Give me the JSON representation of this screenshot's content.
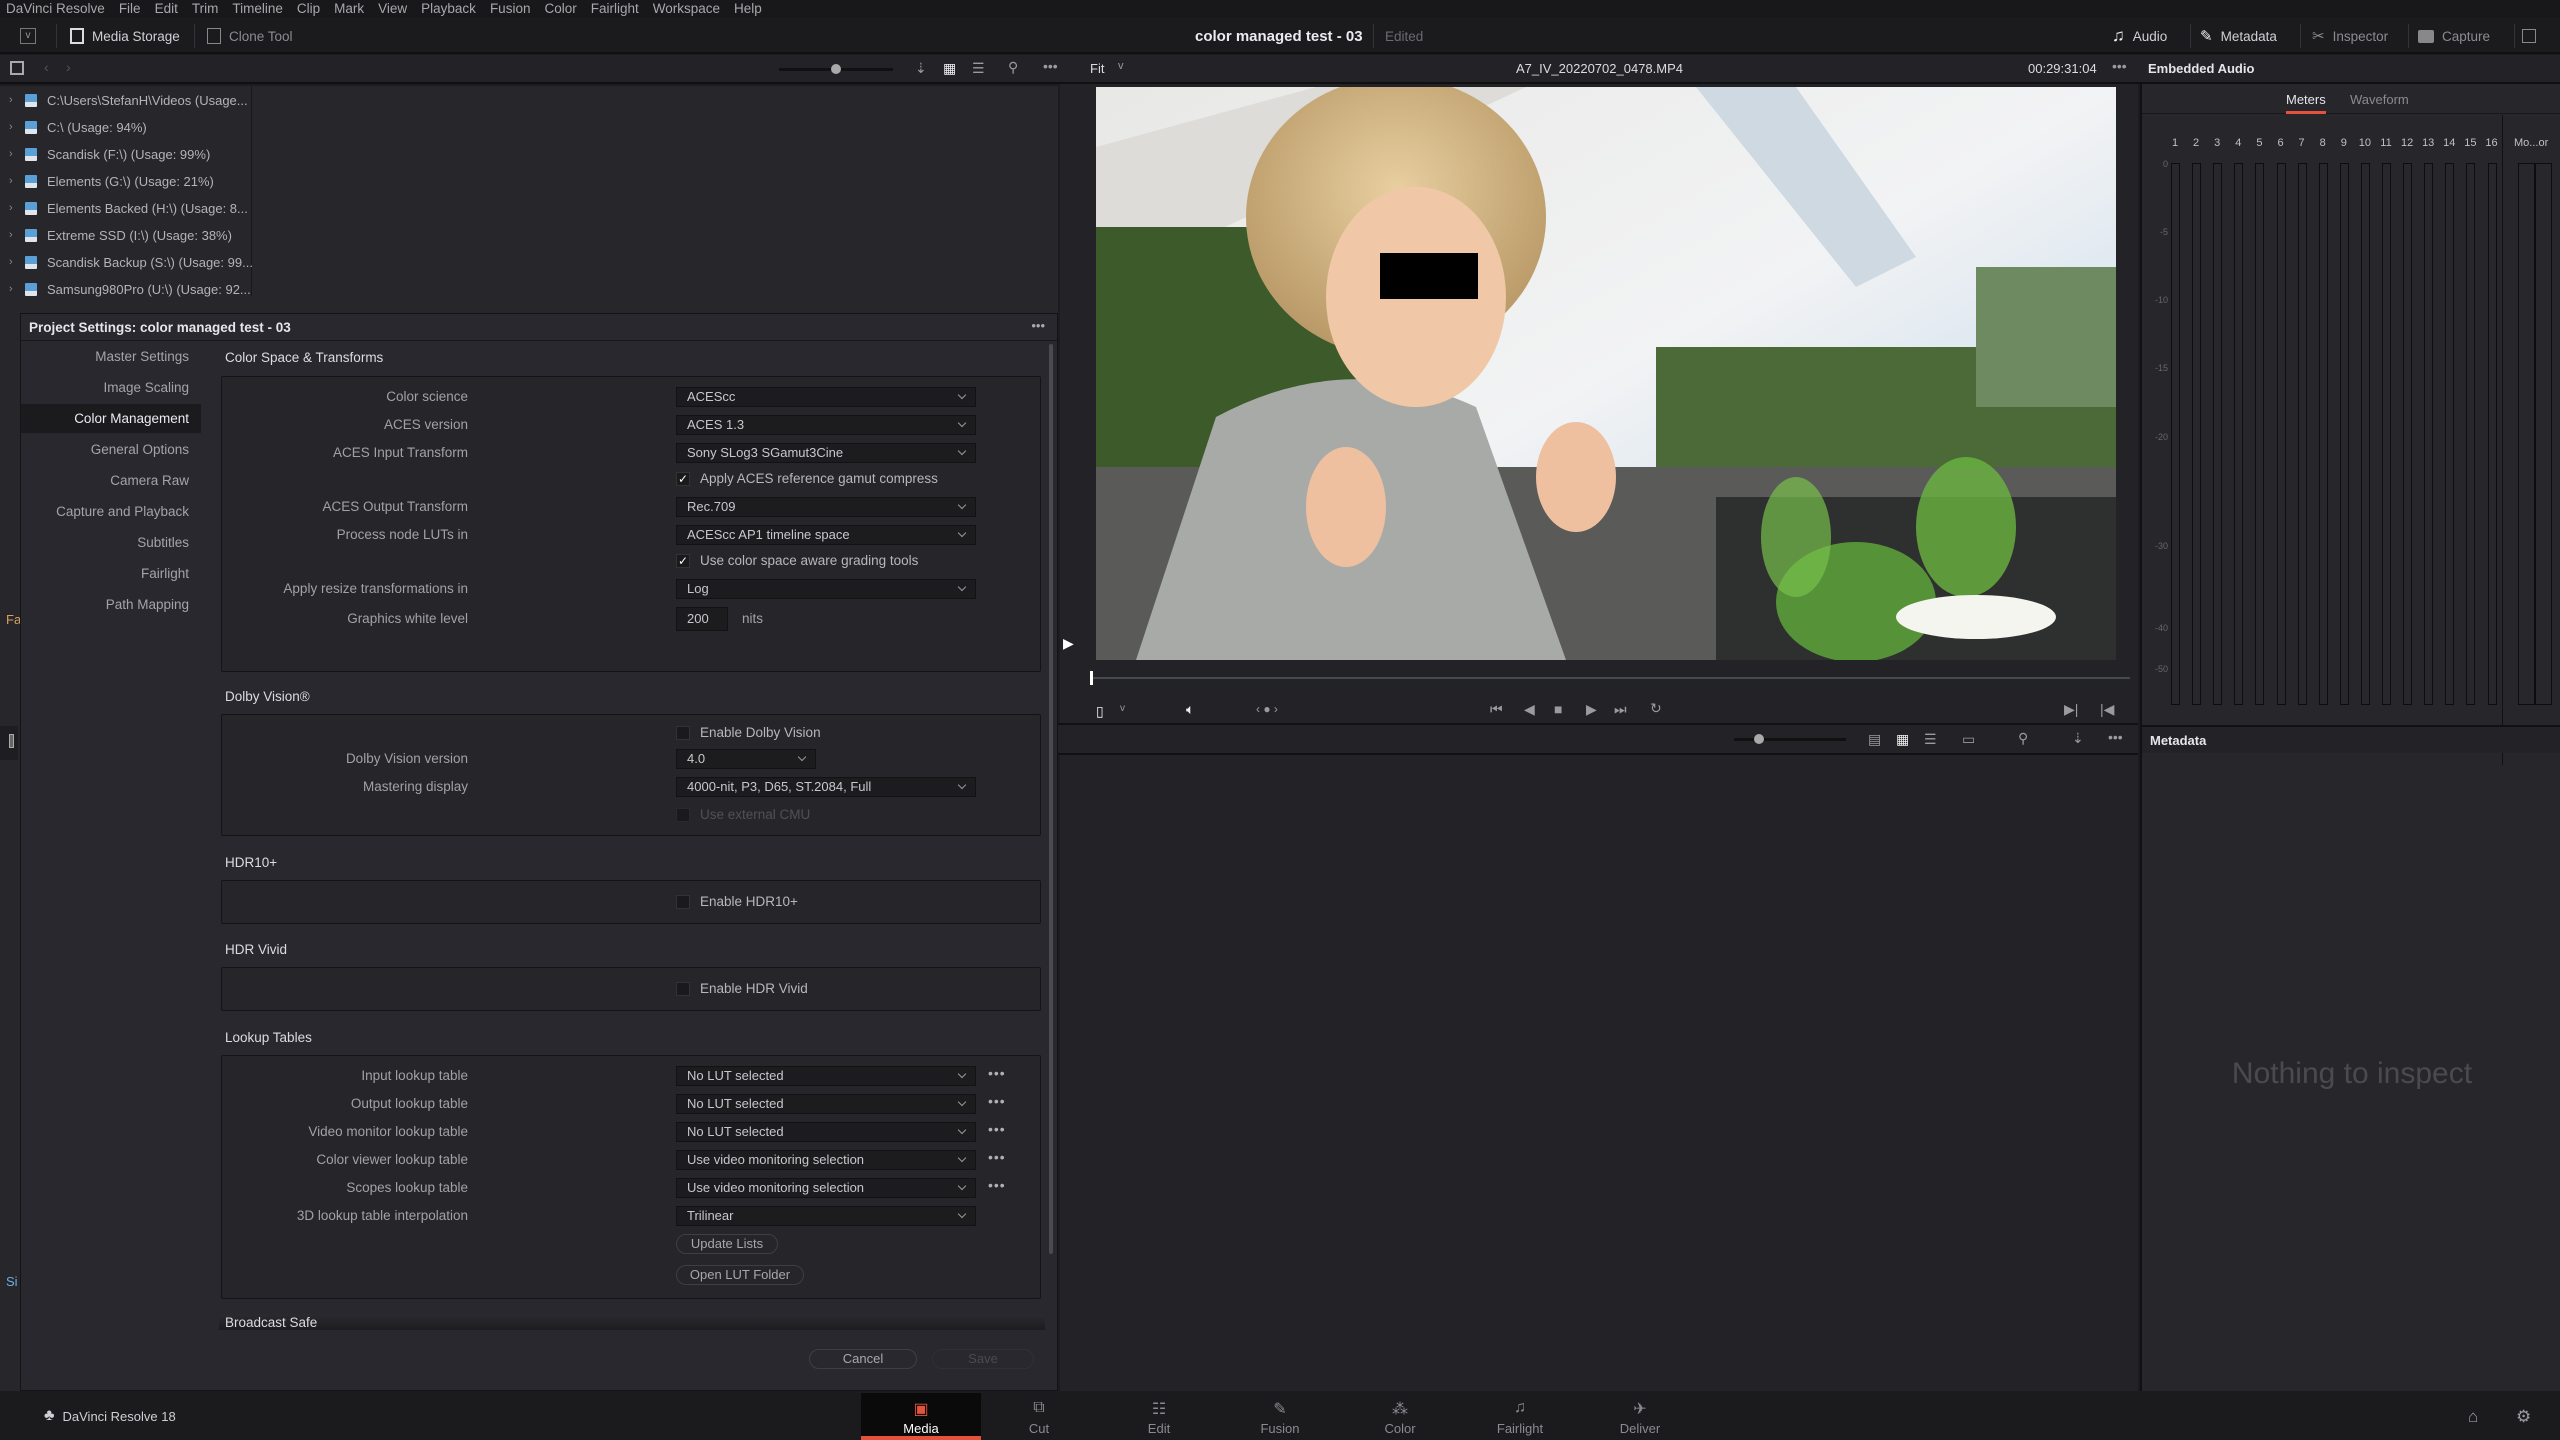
{
  "menu": [
    "DaVinci Resolve",
    "File",
    "Edit",
    "Trim",
    "Timeline",
    "Clip",
    "Mark",
    "View",
    "Playback",
    "Fusion",
    "Color",
    "Fairlight",
    "Workspace",
    "Help"
  ],
  "toolbar": {
    "media_storage": "Media Storage",
    "clone_tool": "Clone Tool",
    "project_title": "color managed test - 03",
    "edited": "Edited",
    "audio": "Audio",
    "metadata": "Metadata",
    "inspector": "Inspector",
    "capture": "Capture"
  },
  "viewer": {
    "zoom": "Fit",
    "clip_name": "A7_IV_20220702_0478.MP4",
    "timecode": "00:29:31:04",
    "playhead_fraction": 0
  },
  "drives": [
    "C:\\Users\\StefanH\\Videos (Usage...",
    "C:\\ (Usage: 94%)",
    "Scandisk (F:\\) (Usage: 99%)",
    "Elements (G:\\) (Usage: 21%)",
    "Elements Backed (H:\\) (Usage: 8...",
    "Extreme SSD (I:\\) (Usage: 38%)",
    "Scandisk Backup (S:\\) (Usage: 99...",
    "Samsung980Pro (U:\\) (Usage: 92..."
  ],
  "left_edge": {
    "item1": "Fa",
    "item2": "Si"
  },
  "dialog": {
    "title": "Project Settings:  color managed test - 03",
    "nav": [
      "Master Settings",
      "Image Scaling",
      "Color Management",
      "General Options",
      "Camera Raw",
      "Capture and Playback",
      "Subtitles",
      "Fairlight",
      "Path Mapping"
    ],
    "active_nav": "Color Management",
    "color_space": {
      "heading": "Color Space & Transforms",
      "color_science_label": "Color science",
      "color_science": "ACEScc",
      "aces_version_label": "ACES version",
      "aces_version": "ACES 1.3",
      "input_transform_label": "ACES Input Transform",
      "input_transform": "Sony SLog3 SGamut3Cine",
      "gamut_compress": "Apply ACES reference gamut compress",
      "gamut_compress_checked": true,
      "output_transform_label": "ACES Output Transform",
      "output_transform": "Rec.709",
      "process_luts_label": "Process node LUTs in",
      "process_luts": "ACEScc AP1 timeline space",
      "color_aware": "Use color space aware grading tools",
      "color_aware_checked": true,
      "resize_label": "Apply resize transformations in",
      "resize": "Log",
      "white_level_label": "Graphics white level",
      "white_level": "200",
      "white_level_unit": "nits"
    },
    "dolby": {
      "heading": "Dolby Vision®",
      "enable": "Enable Dolby Vision",
      "enable_checked": false,
      "version_label": "Dolby Vision version",
      "version": "4.0",
      "mastering_label": "Mastering display",
      "mastering": "4000-nit, P3, D65, ST.2084, Full",
      "external_cmu": "Use external CMU"
    },
    "hdr10": {
      "heading": "HDR10+",
      "enable": "Enable HDR10+",
      "enable_checked": false
    },
    "hdrvivid": {
      "heading": "HDR Vivid",
      "enable": "Enable HDR Vivid",
      "enable_checked": false
    },
    "luts": {
      "heading": "Lookup Tables",
      "rows": [
        {
          "label": "Input lookup table",
          "value": "No LUT selected"
        },
        {
          "label": "Output lookup table",
          "value": "No LUT selected"
        },
        {
          "label": "Video monitor lookup table",
          "value": "No LUT selected"
        },
        {
          "label": "Color viewer lookup table",
          "value": "Use video monitoring selection"
        },
        {
          "label": "Scopes lookup table",
          "value": "Use video monitoring selection"
        }
      ],
      "interp_label": "3D lookup table interpolation",
      "interp": "Trilinear",
      "update_lists": "Update Lists",
      "open_folder": "Open LUT Folder"
    },
    "broadcast_safe": "Broadcast Safe",
    "cancel": "Cancel",
    "save": "Save"
  },
  "audio": {
    "title": "Embedded Audio",
    "tabs": [
      "Meters",
      "Waveform"
    ],
    "active_tab": "Meters",
    "channels": [
      "1",
      "2",
      "3",
      "4",
      "5",
      "6",
      "7",
      "8",
      "9",
      "10",
      "11",
      "12",
      "13",
      "14",
      "15",
      "16"
    ],
    "monitor_label": "Mo...or",
    "db_ticks": [
      "0",
      "-5",
      "-10",
      "-15",
      "-20",
      "-30",
      "-40",
      "-50"
    ],
    "levels": [
      0,
      0,
      0,
      0,
      0,
      0,
      0,
      0,
      0,
      0,
      0,
      0,
      0,
      0,
      0,
      0
    ]
  },
  "metadata": {
    "title": "Metadata",
    "empty": "Nothing to inspect"
  },
  "pages": [
    "Media",
    "Cut",
    "Edit",
    "Fusion",
    "Color",
    "Fairlight",
    "Deliver"
  ],
  "active_page": "Media",
  "app_name": "DaVinci Resolve 18",
  "colors": {
    "accent": "#e2523c",
    "background": "#1c1c20",
    "panel": "#28282e"
  }
}
